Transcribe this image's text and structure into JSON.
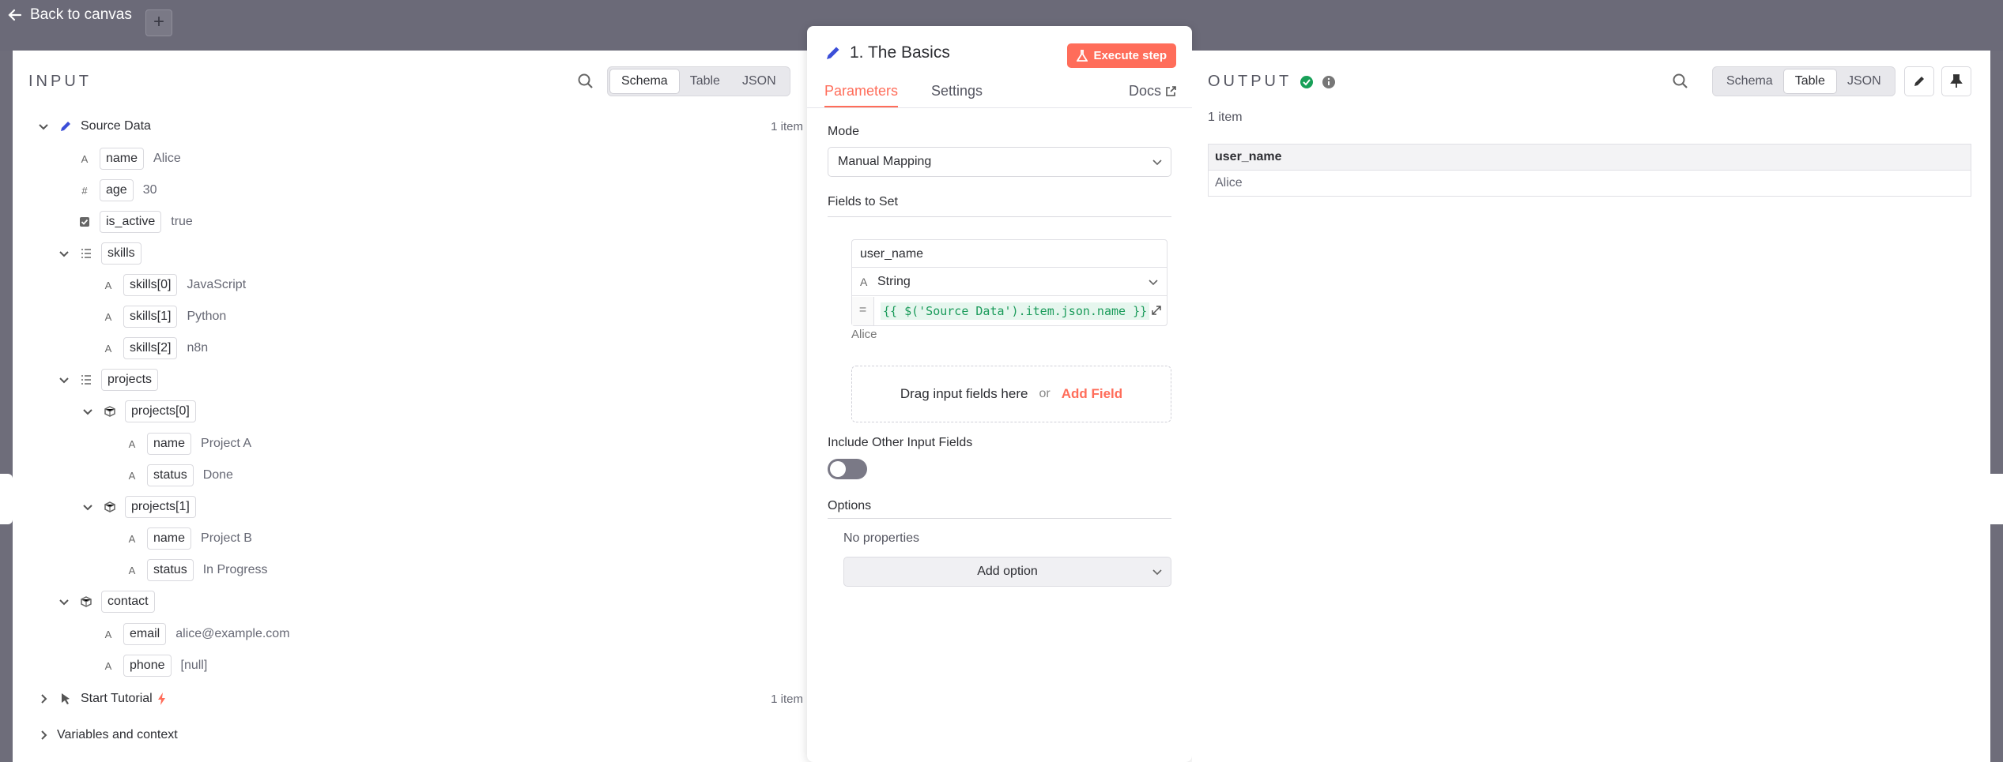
{
  "nav": {
    "back_label": "Back to canvas",
    "add_symbol": "+"
  },
  "input": {
    "title": "INPUT",
    "views": [
      "Schema",
      "Table",
      "JSON"
    ],
    "active_view": "Schema",
    "source": {
      "name": "Source Data",
      "count": "1 item"
    },
    "fields": {
      "name": {
        "key": "name",
        "value": "Alice"
      },
      "age": {
        "key": "age",
        "value": "30"
      },
      "is_active": {
        "key": "is_active",
        "value": "true"
      },
      "skills": {
        "key": "skills"
      },
      "skills_0": {
        "key": "skills[0]",
        "value": "JavaScript"
      },
      "skills_1": {
        "key": "skills[1]",
        "value": "Python"
      },
      "skills_2": {
        "key": "skills[2]",
        "value": "n8n"
      },
      "projects": {
        "key": "projects"
      },
      "projects_0": {
        "key": "projects[0]"
      },
      "p0_name": {
        "key": "name",
        "value": "Project A"
      },
      "p0_status": {
        "key": "status",
        "value": "Done"
      },
      "projects_1": {
        "key": "projects[1]"
      },
      "p1_name": {
        "key": "name",
        "value": "Project B"
      },
      "p1_status": {
        "key": "status",
        "value": "In Progress"
      },
      "contact": {
        "key": "contact"
      },
      "email": {
        "key": "email",
        "value": "alice@example.com"
      },
      "phone": {
        "key": "phone",
        "value": "[null]"
      }
    },
    "tutorial": {
      "name": "Start Tutorial",
      "count": "1 item"
    },
    "variables": "Variables and context"
  },
  "node": {
    "title": "1. The Basics",
    "execute_label": "Execute step",
    "tabs": [
      "Parameters",
      "Settings"
    ],
    "docs_label": "Docs",
    "mode_label": "Mode",
    "mode_value": "Manual Mapping",
    "fields_label": "Fields to Set",
    "field": {
      "name": "user_name",
      "type": "String",
      "eq": "=",
      "expression": "{{ $('Source Data').item.json.name }}",
      "preview": "Alice"
    },
    "dropzone": {
      "text": "Drag input fields here",
      "or": "or",
      "add": "Add Field"
    },
    "include_label": "Include Other Input Fields",
    "options_label": "Options",
    "no_props": "No properties",
    "add_option": "Add option"
  },
  "output": {
    "title": "OUTPUT",
    "views": [
      "Schema",
      "Table",
      "JSON"
    ],
    "active_view": "Table",
    "items": "1 item",
    "columns": [
      "user_name"
    ],
    "rows": [
      [
        "Alice"
      ]
    ]
  },
  "colors": {
    "accent": "#ff6d5a",
    "success": "#18a058",
    "node_icon": "#3b4ed8"
  }
}
